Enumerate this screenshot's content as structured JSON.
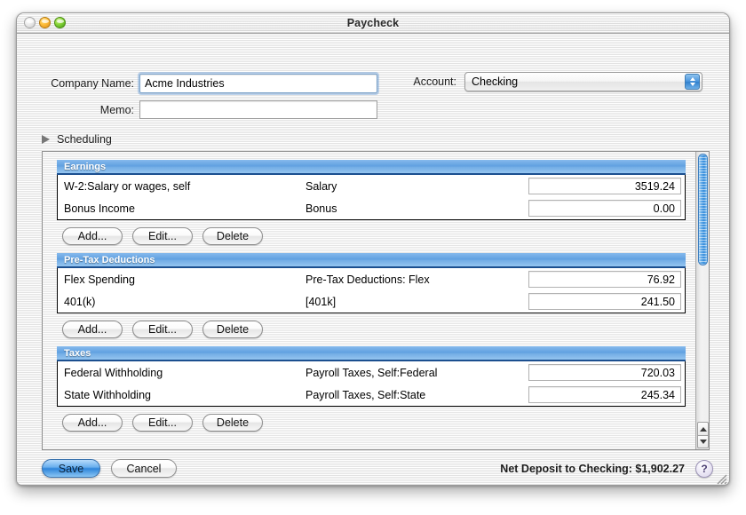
{
  "window": {
    "title": "Paycheck",
    "controls": {
      "close": "close",
      "minimize": "minimize",
      "zoom": "zoom"
    }
  },
  "form": {
    "company_label": "Company Name:",
    "company_value": "Acme Industries",
    "memo_label": "Memo:",
    "memo_value": "",
    "account_label": "Account:",
    "account_value": "Checking"
  },
  "scheduling": {
    "label": "Scheduling",
    "expanded": false
  },
  "sections": [
    {
      "title": "Earnings",
      "rows": [
        {
          "name": "W-2:Salary or wages, self",
          "category": "Salary",
          "amount": "3519.24"
        },
        {
          "name": "Bonus Income",
          "category": "Bonus",
          "amount": "0.00"
        }
      ],
      "buttons": {
        "add": "Add...",
        "edit": "Edit...",
        "delete": "Delete"
      }
    },
    {
      "title": "Pre-Tax Deductions",
      "rows": [
        {
          "name": "Flex Spending",
          "category": "Pre-Tax Deductions: Flex",
          "amount": "76.92"
        },
        {
          "name": "401(k)",
          "category": "[401k]",
          "amount": "241.50"
        }
      ],
      "buttons": {
        "add": "Add...",
        "edit": "Edit...",
        "delete": "Delete"
      }
    },
    {
      "title": "Taxes",
      "rows": [
        {
          "name": "Federal Withholding",
          "category": "Payroll Taxes, Self:Federal",
          "amount": "720.03"
        },
        {
          "name": "State Withholding",
          "category": "Payroll Taxes, Self:State",
          "amount": "245.34"
        }
      ],
      "buttons": {
        "add": "Add...",
        "edit": "Edit...",
        "delete": "Delete"
      }
    }
  ],
  "footer": {
    "save_label": "Save",
    "cancel_label": "Cancel",
    "net_deposit": "Net Deposit to Checking: $1,902.27",
    "help_label": "?"
  },
  "colors": {
    "section_header_blue": "#5e9fe0",
    "section_header_border": "#1b4f8f",
    "default_button_blue": "#2f85da",
    "scrollbar_thumb": "#2b86d8",
    "window_chrome": "#eaeaea"
  }
}
